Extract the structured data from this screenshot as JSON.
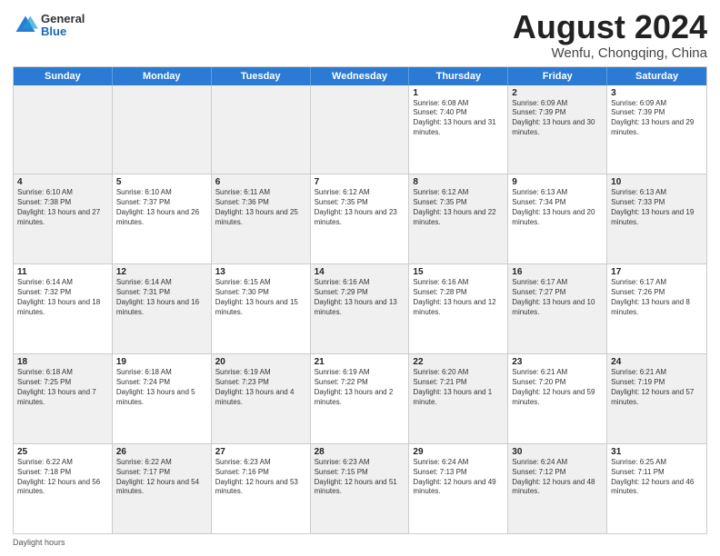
{
  "header": {
    "logo": {
      "general": "General",
      "blue": "Blue"
    },
    "title": "August 2024",
    "location": "Wenfu, Chongqing, China"
  },
  "days_of_week": [
    "Sunday",
    "Monday",
    "Tuesday",
    "Wednesday",
    "Thursday",
    "Friday",
    "Saturday"
  ],
  "weeks": [
    [
      {
        "day": "",
        "info": "",
        "shaded": true
      },
      {
        "day": "",
        "info": "",
        "shaded": true
      },
      {
        "day": "",
        "info": "",
        "shaded": true
      },
      {
        "day": "",
        "info": "",
        "shaded": true
      },
      {
        "day": "1",
        "info": "Sunrise: 6:08 AM\nSunset: 7:40 PM\nDaylight: 13 hours and 31 minutes."
      },
      {
        "day": "2",
        "info": "Sunrise: 6:09 AM\nSunset: 7:39 PM\nDaylight: 13 hours and 30 minutes.",
        "shaded": true
      },
      {
        "day": "3",
        "info": "Sunrise: 6:09 AM\nSunset: 7:39 PM\nDaylight: 13 hours and 29 minutes."
      }
    ],
    [
      {
        "day": "4",
        "info": "Sunrise: 6:10 AM\nSunset: 7:38 PM\nDaylight: 13 hours and 27 minutes.",
        "shaded": true
      },
      {
        "day": "5",
        "info": "Sunrise: 6:10 AM\nSunset: 7:37 PM\nDaylight: 13 hours and 26 minutes."
      },
      {
        "day": "6",
        "info": "Sunrise: 6:11 AM\nSunset: 7:36 PM\nDaylight: 13 hours and 25 minutes.",
        "shaded": true
      },
      {
        "day": "7",
        "info": "Sunrise: 6:12 AM\nSunset: 7:35 PM\nDaylight: 13 hours and 23 minutes."
      },
      {
        "day": "8",
        "info": "Sunrise: 6:12 AM\nSunset: 7:35 PM\nDaylight: 13 hours and 22 minutes.",
        "shaded": true
      },
      {
        "day": "9",
        "info": "Sunrise: 6:13 AM\nSunset: 7:34 PM\nDaylight: 13 hours and 20 minutes."
      },
      {
        "day": "10",
        "info": "Sunrise: 6:13 AM\nSunset: 7:33 PM\nDaylight: 13 hours and 19 minutes.",
        "shaded": true
      }
    ],
    [
      {
        "day": "11",
        "info": "Sunrise: 6:14 AM\nSunset: 7:32 PM\nDaylight: 13 hours and 18 minutes."
      },
      {
        "day": "12",
        "info": "Sunrise: 6:14 AM\nSunset: 7:31 PM\nDaylight: 13 hours and 16 minutes.",
        "shaded": true
      },
      {
        "day": "13",
        "info": "Sunrise: 6:15 AM\nSunset: 7:30 PM\nDaylight: 13 hours and 15 minutes."
      },
      {
        "day": "14",
        "info": "Sunrise: 6:16 AM\nSunset: 7:29 PM\nDaylight: 13 hours and 13 minutes.",
        "shaded": true
      },
      {
        "day": "15",
        "info": "Sunrise: 6:16 AM\nSunset: 7:28 PM\nDaylight: 13 hours and 12 minutes."
      },
      {
        "day": "16",
        "info": "Sunrise: 6:17 AM\nSunset: 7:27 PM\nDaylight: 13 hours and 10 minutes.",
        "shaded": true
      },
      {
        "day": "17",
        "info": "Sunrise: 6:17 AM\nSunset: 7:26 PM\nDaylight: 13 hours and 8 minutes."
      }
    ],
    [
      {
        "day": "18",
        "info": "Sunrise: 6:18 AM\nSunset: 7:25 PM\nDaylight: 13 hours and 7 minutes.",
        "shaded": true
      },
      {
        "day": "19",
        "info": "Sunrise: 6:18 AM\nSunset: 7:24 PM\nDaylight: 13 hours and 5 minutes."
      },
      {
        "day": "20",
        "info": "Sunrise: 6:19 AM\nSunset: 7:23 PM\nDaylight: 13 hours and 4 minutes.",
        "shaded": true
      },
      {
        "day": "21",
        "info": "Sunrise: 6:19 AM\nSunset: 7:22 PM\nDaylight: 13 hours and 2 minutes."
      },
      {
        "day": "22",
        "info": "Sunrise: 6:20 AM\nSunset: 7:21 PM\nDaylight: 13 hours and 1 minute.",
        "shaded": true
      },
      {
        "day": "23",
        "info": "Sunrise: 6:21 AM\nSunset: 7:20 PM\nDaylight: 12 hours and 59 minutes."
      },
      {
        "day": "24",
        "info": "Sunrise: 6:21 AM\nSunset: 7:19 PM\nDaylight: 12 hours and 57 minutes.",
        "shaded": true
      }
    ],
    [
      {
        "day": "25",
        "info": "Sunrise: 6:22 AM\nSunset: 7:18 PM\nDaylight: 12 hours and 56 minutes."
      },
      {
        "day": "26",
        "info": "Sunrise: 6:22 AM\nSunset: 7:17 PM\nDaylight: 12 hours and 54 minutes.",
        "shaded": true
      },
      {
        "day": "27",
        "info": "Sunrise: 6:23 AM\nSunset: 7:16 PM\nDaylight: 12 hours and 53 minutes."
      },
      {
        "day": "28",
        "info": "Sunrise: 6:23 AM\nSunset: 7:15 PM\nDaylight: 12 hours and 51 minutes.",
        "shaded": true
      },
      {
        "day": "29",
        "info": "Sunrise: 6:24 AM\nSunset: 7:13 PM\nDaylight: 12 hours and 49 minutes."
      },
      {
        "day": "30",
        "info": "Sunrise: 6:24 AM\nSunset: 7:12 PM\nDaylight: 12 hours and 48 minutes.",
        "shaded": true
      },
      {
        "day": "31",
        "info": "Sunrise: 6:25 AM\nSunset: 7:11 PM\nDaylight: 12 hours and 46 minutes."
      }
    ]
  ],
  "footer": {
    "label": "Daylight hours"
  }
}
